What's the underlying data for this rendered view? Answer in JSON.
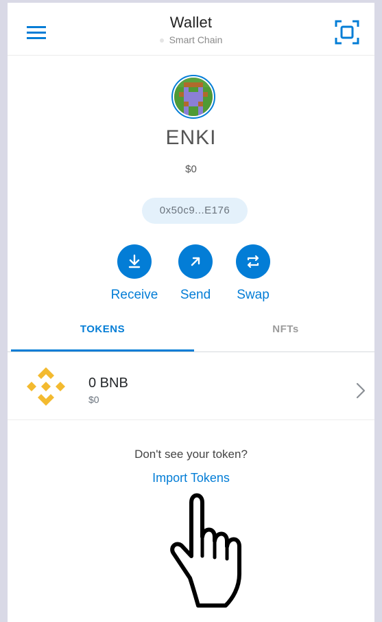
{
  "header": {
    "title": "Wallet",
    "network": "Smart Chain",
    "menu_icon": "hamburger-menu-icon",
    "scan_icon": "qr-scan-icon"
  },
  "account": {
    "name": "ENKI",
    "balance": "$0",
    "address": "0x50c9...E176"
  },
  "actions": [
    {
      "label": "Receive",
      "icon": "download-icon"
    },
    {
      "label": "Send",
      "icon": "arrow-up-right-icon"
    },
    {
      "label": "Swap",
      "icon": "swap-arrows-icon"
    }
  ],
  "tabs": [
    {
      "label": "TOKENS",
      "active": true
    },
    {
      "label": "NFTs",
      "active": false
    }
  ],
  "tokens": [
    {
      "amount": "0 BNB",
      "fiat": "$0",
      "icon": "bnb-logo-icon"
    }
  ],
  "import": {
    "prompt": "Don't see your token?",
    "link": "Import Tokens"
  },
  "colors": {
    "accent": "#037dd6",
    "bnb": "#f3ba2f",
    "address_bg": "#e4f1fb",
    "page_bg": "#d9d9e6"
  }
}
